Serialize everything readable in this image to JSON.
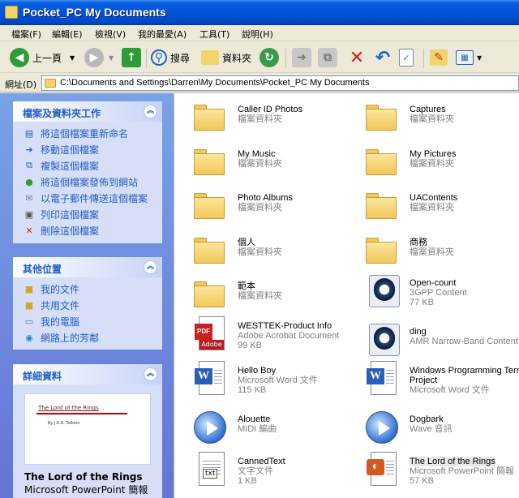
{
  "window": {
    "title": "Pocket_PC My Documents"
  },
  "menu": [
    "檔案(F)",
    "編輯(E)",
    "檢視(V)",
    "我的最愛(A)",
    "工具(T)",
    "說明(H)"
  ],
  "toolbar": {
    "back_label": "上一頁",
    "search_label": "搜尋",
    "folders_label": "資料夾"
  },
  "address": {
    "label": "網址(D)",
    "path": "C:\\Documents and Settings\\Darren\\My Documents\\Pocket_PC My Documents"
  },
  "tasks": {
    "title": "檔案及資料夾工作",
    "items": [
      "將這個檔案重新命名",
      "移動這個檔案",
      "複製這個檔案",
      "將這個檔案發佈到網站",
      "以電子郵件傳送這個檔案",
      "列印這個檔案",
      "刪除這個檔案"
    ]
  },
  "places": {
    "title": "其他位置",
    "items": [
      "我的文件",
      "共用文件",
      "我的電腦",
      "網路上的芳鄰"
    ]
  },
  "details": {
    "title": "詳細資料",
    "thumb_title": "The Lord of the Rings",
    "thumb_author": "By J.R.R. Tolkien",
    "name": "The Lord of the Rings",
    "type": "Microsoft PowerPoint 簡報"
  },
  "files": [
    {
      "name": "Caller ID Photos",
      "l2": "檔案資料夾",
      "l3": "",
      "icon": "folder-icon"
    },
    {
      "name": "Captures",
      "l2": "檔案資料夾",
      "l3": "",
      "icon": "folder-icon"
    },
    {
      "name": "My Music",
      "l2": "檔案資料夾",
      "l3": "",
      "icon": "folder-icon"
    },
    {
      "name": "My Pictures",
      "l2": "檔案資料夾",
      "l3": "",
      "icon": "folder-icon"
    },
    {
      "name": "Photo Albums",
      "l2": "檔案資料夾",
      "l3": "",
      "icon": "folder-icon"
    },
    {
      "name": "UAContents",
      "l2": "檔案資料夾",
      "l3": "",
      "icon": "folder-icon"
    },
    {
      "name": "個人",
      "l2": "檔案資料夾",
      "l3": "",
      "icon": "folder-icon"
    },
    {
      "name": "商務",
      "l2": "檔案資料夾",
      "l3": "",
      "icon": "folder-icon"
    },
    {
      "name": "範本",
      "l2": "檔案資料夾",
      "l3": "",
      "icon": "folder-icon"
    },
    {
      "name": "Open-count",
      "l2": "3GPP Content",
      "l3": "77 KB",
      "icon": "quicktime-icon"
    },
    {
      "name": "WESTTEK-Product Info",
      "l2": "Adobe Acrobat Document",
      "l3": "99 KB",
      "icon": "pdf-icon"
    },
    {
      "name": "ding",
      "l2": "AMR Narrow-Band Content",
      "l3": "",
      "icon": "quicktime-icon"
    },
    {
      "name": "Hello Boy",
      "l2": "Microsoft Word 文件",
      "l3": "115 KB",
      "icon": "word-icon"
    },
    {
      "name": "Windows Programming Term",
      "l2": "Project",
      "l3": "Microsoft Word 文件",
      "icon": "word-icon"
    },
    {
      "name": "Alouette",
      "l2": "MIDI 編曲",
      "l3": "",
      "icon": "media-icon"
    },
    {
      "name": "Dogbark",
      "l2": "Wave 音訊",
      "l3": "",
      "icon": "media-icon"
    },
    {
      "name": "CannedText",
      "l2": "文字文件",
      "l3": "1 KB",
      "icon": "txt-icon"
    },
    {
      "name": "The Lord of the Rings",
      "l2": "Microsoft PowerPoint 簡報",
      "l3": "57 KB",
      "icon": "ppt-icon"
    }
  ],
  "colors": {
    "title_bar": "#0053da",
    "task_link": "#215dc6",
    "pane_bg": "#d6dff7"
  }
}
